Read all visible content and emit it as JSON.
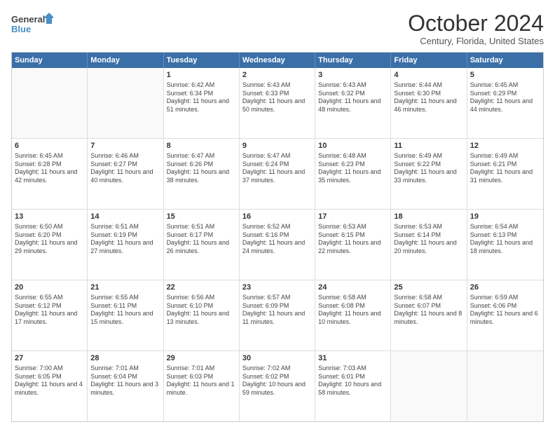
{
  "logo": {
    "line1": "General",
    "line2": "Blue"
  },
  "title": "October 2024",
  "location": "Century, Florida, United States",
  "header_days": [
    "Sunday",
    "Monday",
    "Tuesday",
    "Wednesday",
    "Thursday",
    "Friday",
    "Saturday"
  ],
  "rows": [
    [
      {
        "day": "",
        "text": ""
      },
      {
        "day": "",
        "text": ""
      },
      {
        "day": "1",
        "text": "Sunrise: 6:42 AM\nSunset: 6:34 PM\nDaylight: 11 hours and 51 minutes."
      },
      {
        "day": "2",
        "text": "Sunrise: 6:43 AM\nSunset: 6:33 PM\nDaylight: 11 hours and 50 minutes."
      },
      {
        "day": "3",
        "text": "Sunrise: 6:43 AM\nSunset: 6:32 PM\nDaylight: 11 hours and 48 minutes."
      },
      {
        "day": "4",
        "text": "Sunrise: 6:44 AM\nSunset: 6:30 PM\nDaylight: 11 hours and 46 minutes."
      },
      {
        "day": "5",
        "text": "Sunrise: 6:45 AM\nSunset: 6:29 PM\nDaylight: 11 hours and 44 minutes."
      }
    ],
    [
      {
        "day": "6",
        "text": "Sunrise: 6:45 AM\nSunset: 6:28 PM\nDaylight: 11 hours and 42 minutes."
      },
      {
        "day": "7",
        "text": "Sunrise: 6:46 AM\nSunset: 6:27 PM\nDaylight: 11 hours and 40 minutes."
      },
      {
        "day": "8",
        "text": "Sunrise: 6:47 AM\nSunset: 6:26 PM\nDaylight: 11 hours and 38 minutes."
      },
      {
        "day": "9",
        "text": "Sunrise: 6:47 AM\nSunset: 6:24 PM\nDaylight: 11 hours and 37 minutes."
      },
      {
        "day": "10",
        "text": "Sunrise: 6:48 AM\nSunset: 6:23 PM\nDaylight: 11 hours and 35 minutes."
      },
      {
        "day": "11",
        "text": "Sunrise: 6:49 AM\nSunset: 6:22 PM\nDaylight: 11 hours and 33 minutes."
      },
      {
        "day": "12",
        "text": "Sunrise: 6:49 AM\nSunset: 6:21 PM\nDaylight: 11 hours and 31 minutes."
      }
    ],
    [
      {
        "day": "13",
        "text": "Sunrise: 6:50 AM\nSunset: 6:20 PM\nDaylight: 11 hours and 29 minutes."
      },
      {
        "day": "14",
        "text": "Sunrise: 6:51 AM\nSunset: 6:19 PM\nDaylight: 11 hours and 27 minutes."
      },
      {
        "day": "15",
        "text": "Sunrise: 6:51 AM\nSunset: 6:17 PM\nDaylight: 11 hours and 26 minutes."
      },
      {
        "day": "16",
        "text": "Sunrise: 6:52 AM\nSunset: 6:16 PM\nDaylight: 11 hours and 24 minutes."
      },
      {
        "day": "17",
        "text": "Sunrise: 6:53 AM\nSunset: 6:15 PM\nDaylight: 11 hours and 22 minutes."
      },
      {
        "day": "18",
        "text": "Sunrise: 6:53 AM\nSunset: 6:14 PM\nDaylight: 11 hours and 20 minutes."
      },
      {
        "day": "19",
        "text": "Sunrise: 6:54 AM\nSunset: 6:13 PM\nDaylight: 11 hours and 18 minutes."
      }
    ],
    [
      {
        "day": "20",
        "text": "Sunrise: 6:55 AM\nSunset: 6:12 PM\nDaylight: 11 hours and 17 minutes."
      },
      {
        "day": "21",
        "text": "Sunrise: 6:55 AM\nSunset: 6:11 PM\nDaylight: 11 hours and 15 minutes."
      },
      {
        "day": "22",
        "text": "Sunrise: 6:56 AM\nSunset: 6:10 PM\nDaylight: 11 hours and 13 minutes."
      },
      {
        "day": "23",
        "text": "Sunrise: 6:57 AM\nSunset: 6:09 PM\nDaylight: 11 hours and 11 minutes."
      },
      {
        "day": "24",
        "text": "Sunrise: 6:58 AM\nSunset: 6:08 PM\nDaylight: 11 hours and 10 minutes."
      },
      {
        "day": "25",
        "text": "Sunrise: 6:58 AM\nSunset: 6:07 PM\nDaylight: 11 hours and 8 minutes."
      },
      {
        "day": "26",
        "text": "Sunrise: 6:59 AM\nSunset: 6:06 PM\nDaylight: 11 hours and 6 minutes."
      }
    ],
    [
      {
        "day": "27",
        "text": "Sunrise: 7:00 AM\nSunset: 6:05 PM\nDaylight: 11 hours and 4 minutes."
      },
      {
        "day": "28",
        "text": "Sunrise: 7:01 AM\nSunset: 6:04 PM\nDaylight: 11 hours and 3 minutes."
      },
      {
        "day": "29",
        "text": "Sunrise: 7:01 AM\nSunset: 6:03 PM\nDaylight: 11 hours and 1 minute."
      },
      {
        "day": "30",
        "text": "Sunrise: 7:02 AM\nSunset: 6:02 PM\nDaylight: 10 hours and 59 minutes."
      },
      {
        "day": "31",
        "text": "Sunrise: 7:03 AM\nSunset: 6:01 PM\nDaylight: 10 hours and 58 minutes."
      },
      {
        "day": "",
        "text": ""
      },
      {
        "day": "",
        "text": ""
      }
    ]
  ]
}
